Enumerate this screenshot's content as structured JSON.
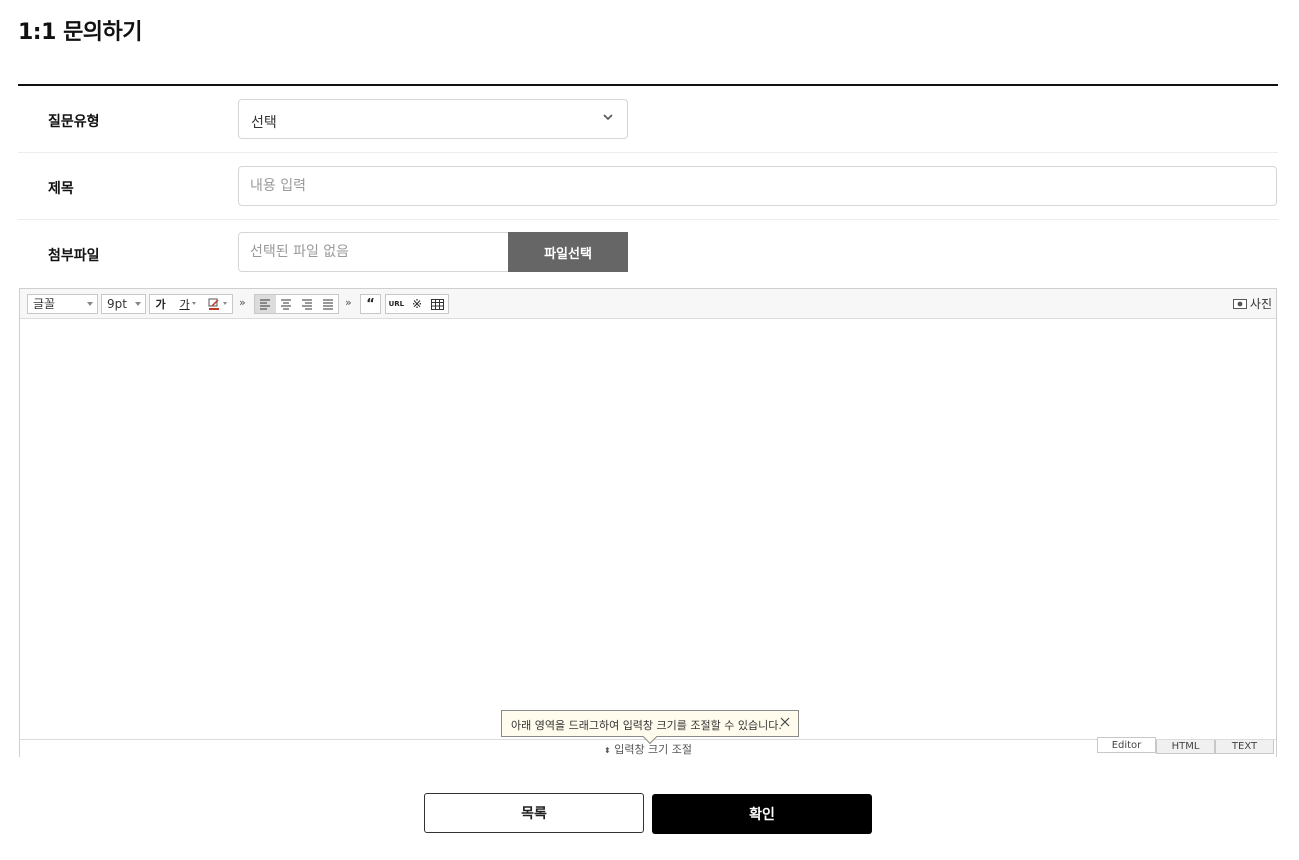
{
  "page": {
    "title": "1:1 문의하기"
  },
  "form": {
    "question_type": {
      "label": "질문유형",
      "value": "선택"
    },
    "subject": {
      "label": "제목",
      "placeholder": "내용 입력"
    },
    "attachment": {
      "label": "첨부파일",
      "placeholder": "선택된 파일 없음",
      "button": "파일선택"
    }
  },
  "editor": {
    "font_value": "글꼴",
    "size_value": "9pt",
    "more_glyph": "»",
    "bold_glyph": "가",
    "underline_glyph": "가",
    "url_label": "URL",
    "photo_label": "사진",
    "resize_label": "입력창 크기 조절",
    "resize_glyph": "⬍",
    "tooltip_text": "아래 영역을 드래그하여 입력창 크기를 조절할 수 있습니다.",
    "modes": [
      "Editor",
      "HTML",
      "TEXT"
    ],
    "active_mode": "Editor"
  },
  "buttons": {
    "list": "목록",
    "confirm": "확인"
  }
}
